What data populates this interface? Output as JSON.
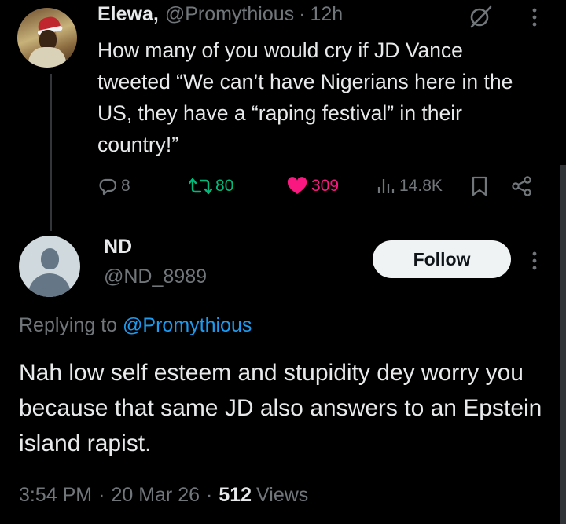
{
  "parent_tweet": {
    "display_name": "Elewa,",
    "handle": "@Promythious",
    "separator": "·",
    "time": "12h",
    "text": "How many of you would cry if JD Vance tweeted “We can’t have Nigerians here in the US, they have a “raping festival” in their country!”",
    "actions": {
      "replies": "8",
      "reposts": "80",
      "likes": "309",
      "views": "14.8K"
    }
  },
  "reply": {
    "display_name": "ND",
    "handle": "@ND_8989",
    "follow_label": "Follow",
    "replying_prefix": "Replying to",
    "replying_mention": "@Promythious",
    "text": "Nah low self esteem and stupidity dey worry you because that same JD also answers to an Epstein island rapist.",
    "time": "3:54 PM",
    "separator": "·",
    "date": "20 Mar 26",
    "views_count": "512",
    "views_label": "Views"
  },
  "colors": {
    "background": "#000000",
    "text_primary": "#e7e9ea",
    "text_secondary": "#71767b",
    "accent_blue": "#1d9bf0",
    "repost_green": "#00ba7c",
    "like_pink": "#f91880"
  },
  "icons": [
    "grok-icon",
    "more-icon",
    "reply-icon",
    "repost-icon",
    "heart-icon",
    "views-icon",
    "bookmark-icon",
    "share-icon"
  ]
}
